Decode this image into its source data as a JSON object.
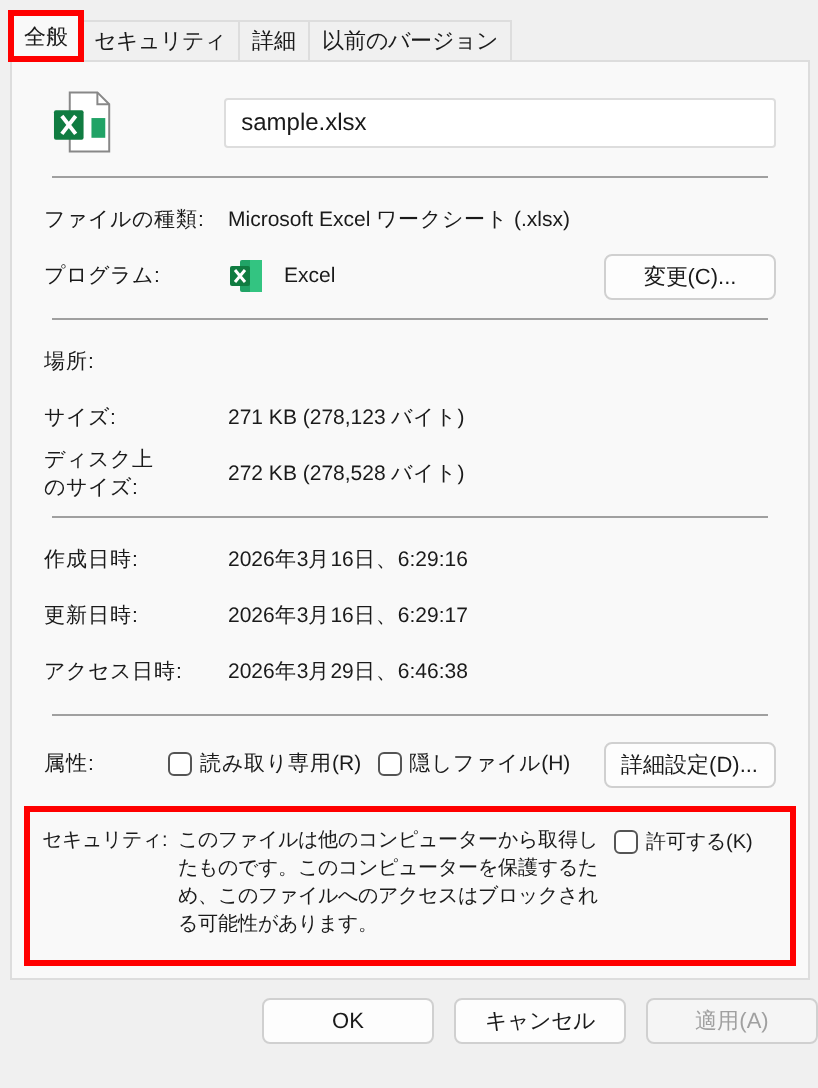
{
  "tabs": [
    {
      "label": "全般",
      "selected": true,
      "highlighted": true
    },
    {
      "label": "セキュリティ",
      "selected": false,
      "highlighted": false
    },
    {
      "label": "詳細",
      "selected": false,
      "highlighted": false
    },
    {
      "label": "以前のバージョン",
      "selected": false,
      "highlighted": false
    }
  ],
  "file_name": {
    "value": "sample.xlsx"
  },
  "file_type": {
    "label": "ファイルの種類:",
    "value": "Microsoft Excel ワークシート (.xlsx)"
  },
  "program": {
    "label": "プログラム:",
    "value": "Excel",
    "button": "変更(C)..."
  },
  "details": [
    {
      "label": "場所:"
    },
    {
      "label": "サイズ:",
      "value": "271 KB (278,123 バイト)"
    },
    {
      "label": "ディスク上のサイズ:",
      "value": "272 KB (278,528 バイト)"
    }
  ],
  "dates": [
    {
      "label": "作成日時:",
      "value": "2026年3月16日、6:29:16"
    },
    {
      "label": "更新日時:",
      "value": "2026年3月16日、6:29:17"
    },
    {
      "label": "アクセス日時:",
      "value": "2026年3月29日、6:46:38"
    }
  ],
  "attributes": {
    "label": "属性:",
    "options": [
      {
        "label": "読み取り専用(R)",
        "checked": false
      },
      {
        "label": "隠しファイル(H)",
        "checked": false
      }
    ],
    "button": "詳細設定(D)..."
  },
  "security": {
    "label": "セキュリティ:",
    "text": "このファイルは他のコンピューターから取得したものです。このコンピューターを保護するため、このファイルへのアクセスはブロックされる可能性があります。",
    "option": {
      "label": "許可する(K)",
      "checked": false
    },
    "highlighted": true
  },
  "buttons": [
    {
      "label": "OK",
      "disabled": false
    },
    {
      "label": "キャンセル",
      "disabled": false
    },
    {
      "label": "適用(A)",
      "disabled": true
    }
  ]
}
